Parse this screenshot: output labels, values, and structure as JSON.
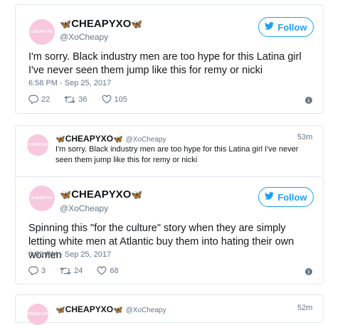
{
  "tweets": [
    {
      "display_name": "CHEAPYXO",
      "handle": "@XoCheapy",
      "avatar_text": "CHEAPYXO",
      "follow_label": "Follow",
      "text": "I'm sorry. Black industry men are too hype for this Latina girl I've never seen them jump like this for remy or nicki",
      "timestamp": "6:58 PM - Sep 25, 2017",
      "replies": "22",
      "retweets": "36",
      "likes": "105"
    },
    {
      "display_name": "CHEAPYXO",
      "handle": "@XoCheapy",
      "avatar_text": "CHEAPYXO",
      "relative_time": "53m",
      "text": "I'm sorry. Black industry men are too hype for this Latina girl I've never seen them jump like this for remy or nicki"
    },
    {
      "display_name": "CHEAPYXO",
      "handle": "@XoCheapy",
      "avatar_text": "CHEAPYXO",
      "follow_label": "Follow",
      "text": "Spinning this \"for the culture\" story when they are simply letting white men at Atlantic buy them into hating their own women",
      "timestamp": "6:59 PM - Sep 25, 2017",
      "replies": "3",
      "retweets": "24",
      "likes": "68"
    },
    {
      "display_name": "CHEAPYXO",
      "handle": "@XoCheapy",
      "avatar_text": "CHEAPYXO",
      "relative_time": "52m"
    }
  ],
  "icons": {
    "butterfly": "butterfly-icon",
    "bird": "twitter-bird-icon",
    "reply": "reply-icon",
    "retweet": "retweet-icon",
    "like": "heart-icon",
    "info": "info-icon"
  },
  "colors": {
    "accent": "#1da1f2",
    "avatar_bg": "#f8c8df",
    "muted": "#657786",
    "border": "#e1e8ed"
  }
}
